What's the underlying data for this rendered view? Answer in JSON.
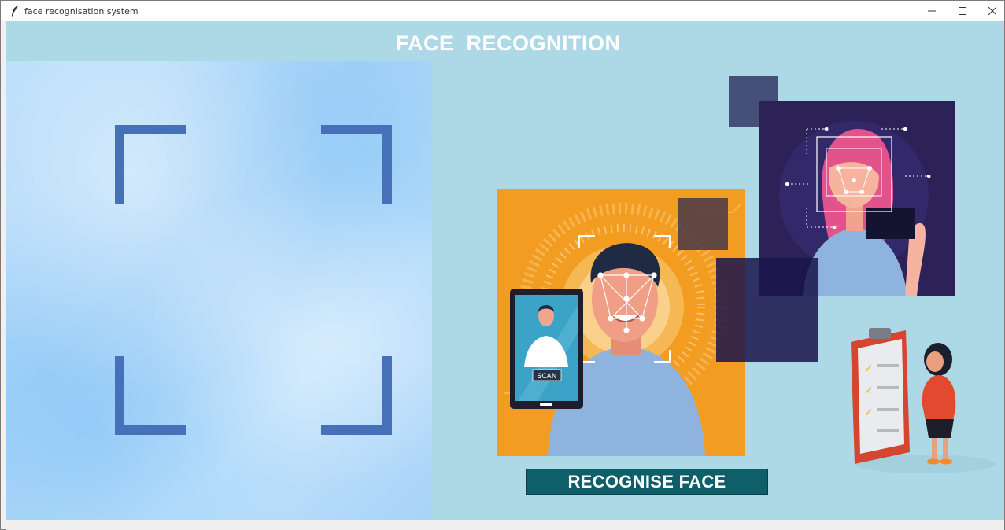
{
  "window": {
    "title": "face recognisation system",
    "controls": {
      "minimize": "minimize-icon",
      "maximize": "maximize-icon",
      "close": "close-icon"
    }
  },
  "main": {
    "heading": "FACE  RECOGNITION",
    "recognise_button": "RECOGNISE FACE",
    "phone_scan_label": "SCAN"
  },
  "colors": {
    "background": "#add8e6",
    "button_bg": "#0f5f6a",
    "frame_corners": "#4670b8",
    "orange_panel": "#f39c22",
    "purple_panel": "#2c2257"
  }
}
